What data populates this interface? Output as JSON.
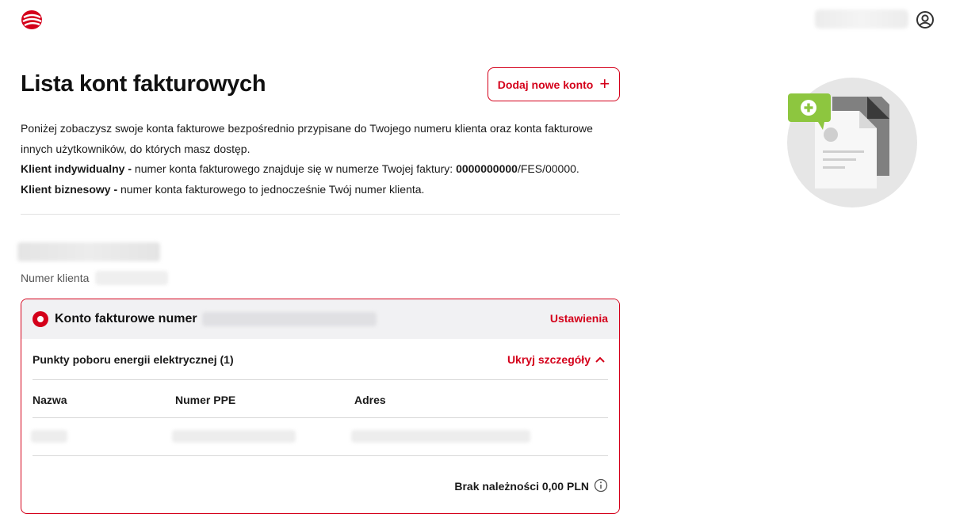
{
  "header": {
    "logo_icon": "brand-logo-icon",
    "user_icon": "user-circle-icon",
    "brand_color": "#d4001a"
  },
  "main": {
    "title": "Lista kont fakturowych",
    "add_button_label": "Dodaj nowe konto",
    "add_button_icon": "plus-icon",
    "intro_line1": "Poniżej zobaczysz swoje konta fakturowe bezpośrednio przypisane do Twojego numeru klienta oraz konta fakturowe innych użytkowników, do których masz dostęp.",
    "individual_label": "Klient indywidualny -",
    "individual_text": " numer konta fakturowego znajduje się w numerze Twojej faktury: ",
    "invoice_bold": "0000000000",
    "invoice_rest": "/FES/00000.",
    "business_label": "Klient biznesowy -",
    "business_text": " numer konta fakturowego to jednocześnie Twój numer klienta.",
    "client_number_label": "Numer klienta"
  },
  "account_card": {
    "title": "Konto fakturowe numer",
    "settings_label": "Ustawienia",
    "points_label": "Punkty poboru energii elektrycznej (1)",
    "toggle_label": "Ukryj szczegóły",
    "toggle_icon": "chevron-up-icon",
    "columns": [
      "Nazwa",
      "Numer PPE",
      "Adres"
    ],
    "balance_text": "Brak należności 0,00 PLN",
    "info_icon": "info-icon"
  },
  "illustration": {
    "icon": "document-add-illustration",
    "accent": "#8dc63f"
  }
}
